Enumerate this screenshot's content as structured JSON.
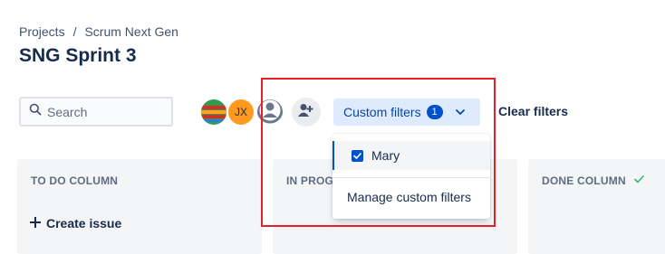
{
  "breadcrumb": {
    "items": [
      "Projects",
      "Scrum Next Gen"
    ],
    "separator": "/"
  },
  "page_title": "SNG Sprint 3",
  "search": {
    "placeholder": "Search",
    "value": ""
  },
  "avatars": [
    {
      "name": "colorful-avatar",
      "initials": ""
    },
    {
      "name": "jx-avatar",
      "initials": "JX"
    },
    {
      "name": "default-user-avatar",
      "initials": ""
    }
  ],
  "toolbar": {
    "custom_filters_label": "Custom filters",
    "custom_filters_count": "1",
    "clear_filters_label": "Clear filters"
  },
  "dropdown": {
    "items": [
      {
        "label": "Mary",
        "checked": true
      }
    ],
    "manage_label": "Manage custom filters"
  },
  "columns": [
    {
      "title": "TO DO COLUMN",
      "action": "Create issue"
    },
    {
      "title": "IN PROGR"
    },
    {
      "title": "DONE COLUMN",
      "done": true
    }
  ],
  "colors": {
    "accent": "#0052cc",
    "filter_bg": "#deebff",
    "column_bg": "#f4f5f7",
    "highlight": "#e5202a",
    "done_check": "#36b37e"
  },
  "icons": [
    "search-icon",
    "add-people-icon",
    "chevron-down-icon",
    "checkbox-checked-icon",
    "plus-icon",
    "check-icon",
    "user-icon"
  ]
}
